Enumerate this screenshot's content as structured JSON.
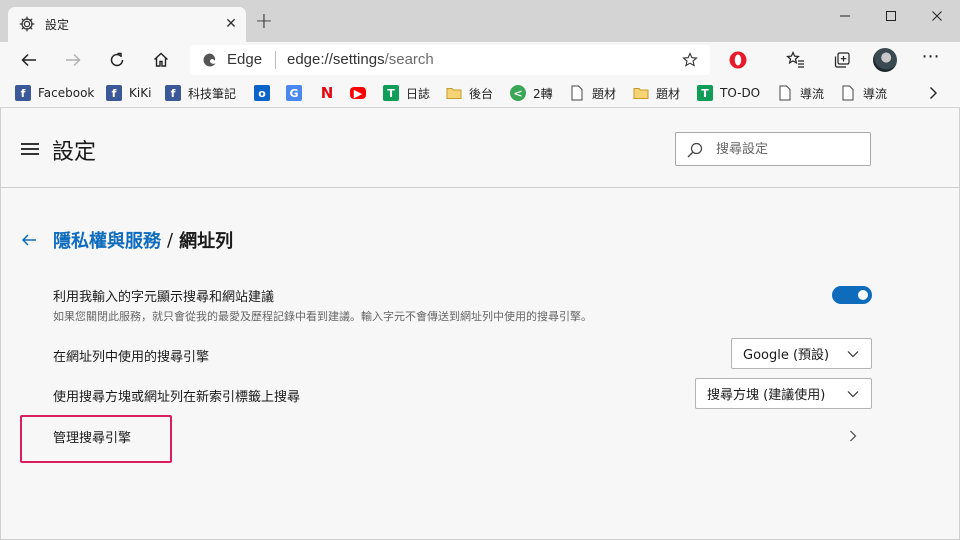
{
  "window": {
    "tab_title": "設定",
    "tab_close": "✕",
    "new_tab": "+",
    "icons": [
      "gear-icon",
      "minimize-icon",
      "maximize-icon",
      "close-icon"
    ]
  },
  "toolbar": {
    "address_brand": "Edge",
    "address_host": "edge://settings",
    "address_path": "/search",
    "icons": [
      "back-icon",
      "forward-icon",
      "refresh-icon",
      "home-icon",
      "favorite-star-icon",
      "opera-o-icon",
      "favorites-icon",
      "collections-icon",
      "profile-avatar",
      "more-icon"
    ]
  },
  "bookmarks": {
    "items": [
      {
        "label": "Facebook",
        "icon": "facebook-icon",
        "color": "#3b5998"
      },
      {
        "label": "KiKi",
        "icon": "facebook-icon",
        "color": "#3b5998"
      },
      {
        "label": "科技筆記",
        "icon": "facebook-icon",
        "color": "#3b5998"
      },
      {
        "label": "",
        "icon": "outlook-icon",
        "color": "#0a64c8"
      },
      {
        "label": "",
        "icon": "translate-icon",
        "color": "#4a88f0"
      },
      {
        "label": "",
        "icon": "netflix-icon",
        "color": "#e50914"
      },
      {
        "label": "",
        "icon": "youtube-icon",
        "color": "#ff0000"
      },
      {
        "label": "日誌",
        "icon": "green-doc-icon",
        "color": "#0f9d58"
      },
      {
        "label": "後台",
        "icon": "folder-icon",
        "color": "#e6b64a"
      },
      {
        "label": "2轉",
        "icon": "share-icon",
        "color": "#3aa757"
      },
      {
        "label": "題材",
        "icon": "page-icon",
        "color": "#555555"
      },
      {
        "label": "題材",
        "icon": "folder-icon",
        "color": "#e6b64a"
      },
      {
        "label": "TO-DO",
        "icon": "green-doc-icon",
        "color": "#0f9d58"
      },
      {
        "label": "導流",
        "icon": "page-icon",
        "color": "#555555"
      },
      {
        "label": "導流",
        "icon": "page-icon",
        "color": "#555555"
      }
    ]
  },
  "settings": {
    "title": "設定",
    "search_placeholder": "搜尋設定",
    "breadcrumb": {
      "parent": "隱私權與服務",
      "separator": "/",
      "current": "網址列"
    },
    "suggestions": {
      "label": "利用我輸入的字元顯示搜尋和網站建議",
      "description": "如果您關閉此服務，就只會從我的最愛及歷程記錄中看到建議。輸入字元不會傳送到網址列中使用的搜尋引擎。",
      "enabled": true
    },
    "engine": {
      "label": "在網址列中使用的搜尋引擎",
      "value": "Google (預設)"
    },
    "new_tab_search": {
      "label": "使用搜尋方塊或網址列在新索引標籤上搜尋",
      "value": "搜尋方塊 (建議使用)"
    },
    "manage": {
      "label": "管理搜尋引擎"
    }
  },
  "colors": {
    "accent": "#0f6cbd",
    "highlight": "#d81e5b",
    "titlebar": "#d4d4d4",
    "surface": "#f7f7f7"
  }
}
